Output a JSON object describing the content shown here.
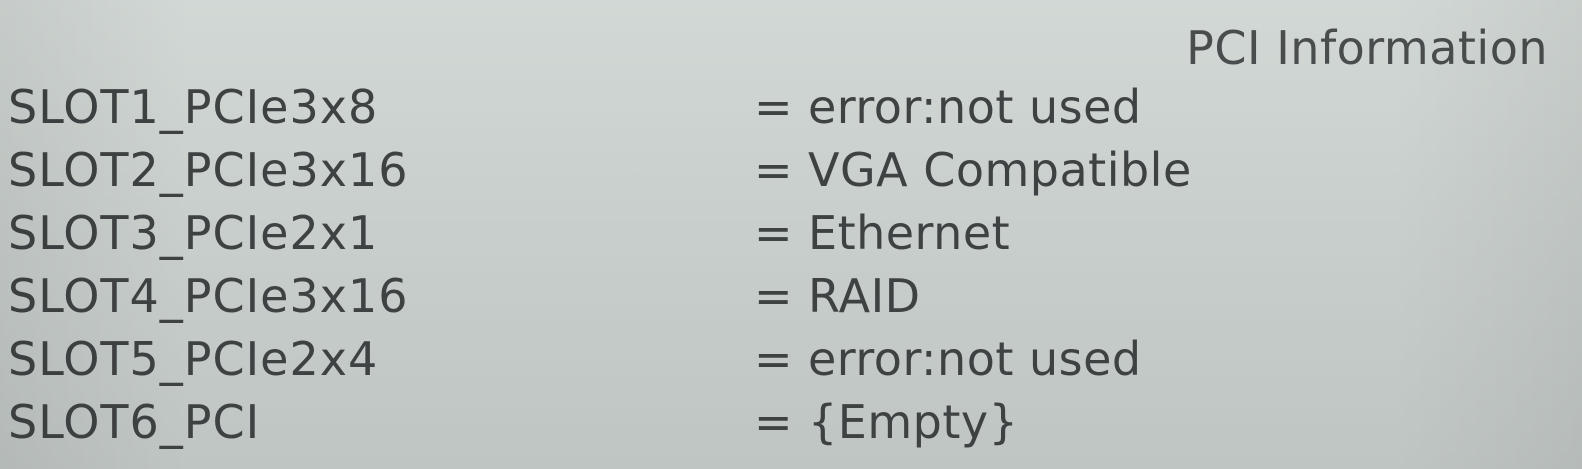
{
  "header": {
    "title": "PCI Information"
  },
  "slots": [
    {
      "name": "SLOT1_PCIe3x8",
      "separator": "=",
      "value": "error:not used"
    },
    {
      "name": "SLOT2_PCIe3x16",
      "separator": "=",
      "value": "VGA Compatible"
    },
    {
      "name": "SLOT3_PCIe2x1",
      "separator": "=",
      "value": "Ethernet"
    },
    {
      "name": "SLOT4_PCIe3x16",
      "separator": "=",
      "value": "RAID"
    },
    {
      "name": "SLOT5_PCIe2x4",
      "separator": "=",
      "value": "error:not used"
    },
    {
      "name": "SLOT6_PCI",
      "separator": "=",
      "value": "{Empty}"
    }
  ],
  "colors": {
    "background": "#c9cfcc",
    "text": "#3f4243"
  }
}
